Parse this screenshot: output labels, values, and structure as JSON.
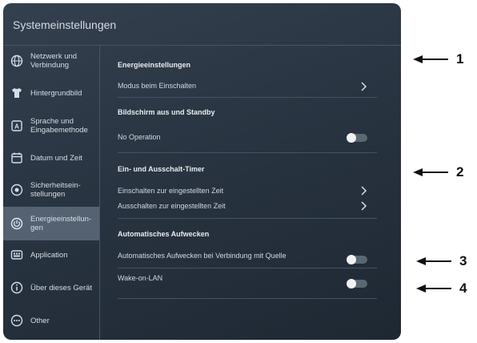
{
  "window": {
    "title": "Systemeinstellungen"
  },
  "sidebar": {
    "items": [
      {
        "label": "Netzwerk und Verbindung",
        "icon": "globe-icon"
      },
      {
        "label": "Hintergrundbild",
        "icon": "shirt-icon"
      },
      {
        "label": "Sprache und Eingabemethode",
        "icon": "keyboard-a-icon"
      },
      {
        "label": "Datum und Zeit",
        "icon": "calendar-icon"
      },
      {
        "label": "Sicherheitsein-stellungen",
        "icon": "security-icon"
      },
      {
        "label": "Energieeinstellun-gen",
        "icon": "power-icon",
        "active": true
      },
      {
        "label": "Application",
        "icon": "app-grid-icon"
      },
      {
        "label": "Über dieses Gerät",
        "icon": "info-icon"
      },
      {
        "label": "Other",
        "icon": "more-icon"
      }
    ]
  },
  "main": {
    "energy": {
      "heading": "Energieeinstellungen",
      "power_on_mode": "Modus beim Einschalten"
    },
    "screen": {
      "heading": "Bildschirm aus und Standby",
      "no_operation": "No Operation"
    },
    "timer": {
      "heading": "Ein- und Ausschalt-Timer",
      "on_timer": "Einschalten zur eingestellten Zeit",
      "off_timer": "Ausschalten zur eingestellten Zeit"
    },
    "wake": {
      "heading": "Automatisches Aufwecken",
      "wake_source": "Automatisches Aufwecken bei Verbindung mit Quelle",
      "wol": "Wake-on-LAN"
    }
  },
  "callouts": [
    "1",
    "2",
    "3",
    "4"
  ],
  "colors": {
    "panel": "#27323f",
    "active": "#546272",
    "text": "#d7dde4"
  }
}
